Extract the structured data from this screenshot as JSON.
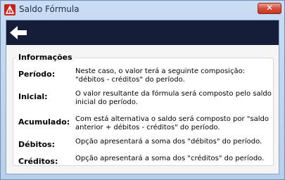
{
  "window": {
    "title": "Saldo Fórmula",
    "close_glyph": "✕",
    "app_icon": "app-logo-icon",
    "back_icon": "arrow-left-icon"
  },
  "info": {
    "heading": "Informações",
    "rows": [
      {
        "label": "Período:",
        "desc": "Neste caso, o valor terá a seguinte composição: \"débitos - créditos\" do período."
      },
      {
        "label": "Inicial:",
        "desc": "O valor resultante da fórmula será composto pelo saldo inicial do período."
      },
      {
        "label": "Acumulado:",
        "desc": "Com está alternativa o saldo será composto por \"saldo anterior + débitos - créditos\" do período."
      },
      {
        "label": "Débitos:",
        "desc": "Opção apresentará a soma dos \"débitos\" do período."
      },
      {
        "label": "Créditos:",
        "desc": "Opção apresentará a soma dos \"créditos\" do período."
      }
    ]
  }
}
